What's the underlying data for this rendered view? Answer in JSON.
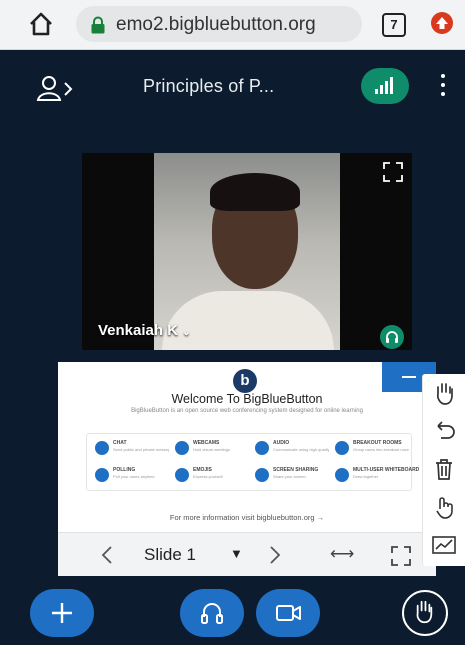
{
  "browser": {
    "url": "emo2.bigbluebutton.org",
    "tab_count": "7"
  },
  "header": {
    "title": "Principles of P..."
  },
  "video": {
    "user_name": "Venkaiah K"
  },
  "presentation": {
    "welcome_title": "Welcome To BigBlueButton",
    "subtitle": "BigBlueButton is an open source web conferencing system designed for online learning",
    "features": [
      {
        "title": "CHAT",
        "desc": "Send public and private messages"
      },
      {
        "title": "WEBCAMS",
        "desc": "Hold visual meetings"
      },
      {
        "title": "AUDIO",
        "desc": "Communicate using high quality audio"
      },
      {
        "title": "BREAKOUT ROOMS",
        "desc": "Group users into breakout rooms"
      },
      {
        "title": "POLLING",
        "desc": "Poll your users anytime"
      },
      {
        "title": "EMOJIS",
        "desc": "Express yourself"
      },
      {
        "title": "SCREEN SHARING",
        "desc": "Share your screen"
      },
      {
        "title": "MULTI-USER WHITEBOARD",
        "desc": "Draw together"
      }
    ],
    "more_info": "For more information visit bigbluebutton.org →",
    "slide_label": "Slide 1"
  },
  "colors": {
    "background": "#0c1b2e",
    "primary": "#1f6fc5",
    "success": "#0f8c6a"
  },
  "icons": {
    "home": "home-icon",
    "lock": "lock-icon",
    "users": "user-chevron-icon",
    "connection": "signal-bars-icon",
    "menu": "kebab-menu-icon",
    "expand": "expand-icon",
    "listen": "headphones-icon",
    "plus": "plus-icon",
    "audio": "headphones-icon",
    "camera": "video-camera-icon",
    "raise_hand": "hand-icon",
    "pan": "hand-icon",
    "undo": "undo-icon",
    "clear": "trash-icon",
    "multi_user": "hand-pointer-icon",
    "draw": "line-chart-icon"
  }
}
